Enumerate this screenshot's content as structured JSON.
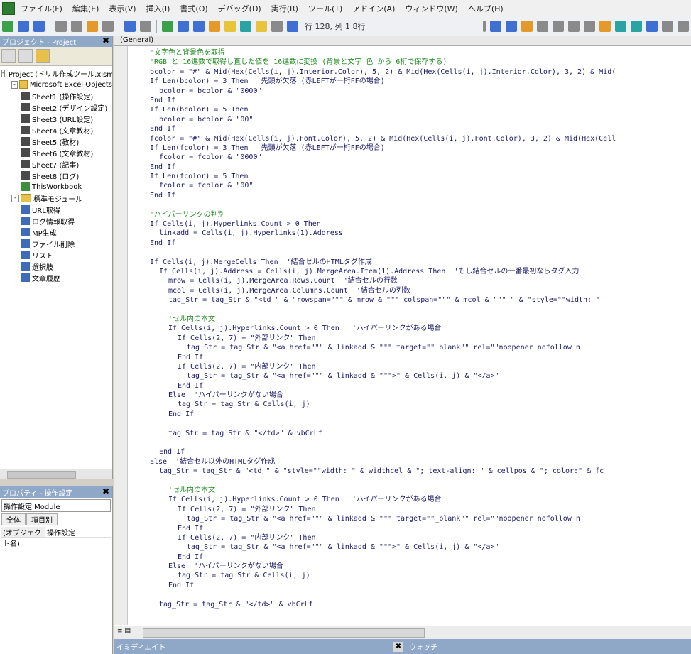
{
  "menubar": {
    "items": [
      "ファイル(F)",
      "編集(E)",
      "表示(V)",
      "挿入(I)",
      "書式(O)",
      "デバッグ(D)",
      "実行(R)",
      "ツール(T)",
      "アドイン(A)",
      "ウィンドウ(W)",
      "ヘルプ(H)"
    ]
  },
  "toolbar": {
    "position_label": "行 128, 列 1 8行"
  },
  "project_pane": {
    "title": "プロジェクト - Project",
    "tree": [
      {
        "label": "Project (ドリル作成ツール.xlsm)",
        "indent": 0,
        "type": "proj",
        "twisty": "-"
      },
      {
        "label": "Microsoft Excel Objects",
        "indent": 1,
        "type": "folder",
        "twisty": "-"
      },
      {
        "label": "Sheet1 (操作設定)",
        "indent": 2,
        "type": "sheet"
      },
      {
        "label": "Sheet2 (デザイン設定)",
        "indent": 2,
        "type": "sheet"
      },
      {
        "label": "Sheet3 (URL設定)",
        "indent": 2,
        "type": "sheet"
      },
      {
        "label": "Sheet4 (文章教材)",
        "indent": 2,
        "type": "sheet"
      },
      {
        "label": "Sheet5 (教材)",
        "indent": 2,
        "type": "sheet"
      },
      {
        "label": "Sheet6 (文章教材)",
        "indent": 2,
        "type": "sheet"
      },
      {
        "label": "Sheet7 (記事)",
        "indent": 2,
        "type": "sheet"
      },
      {
        "label": "Sheet8 (ログ)",
        "indent": 2,
        "type": "sheet"
      },
      {
        "label": "ThisWorkbook",
        "indent": 2,
        "type": "wb"
      },
      {
        "label": "標準モジュール",
        "indent": 1,
        "type": "folder",
        "twisty": "-"
      },
      {
        "label": "URL取得",
        "indent": 2,
        "type": "mod"
      },
      {
        "label": "ログ情報取得",
        "indent": 2,
        "type": "mod"
      },
      {
        "label": "MP生成",
        "indent": 2,
        "type": "mod"
      },
      {
        "label": "ファイル削除",
        "indent": 2,
        "type": "mod"
      },
      {
        "label": "リスト",
        "indent": 2,
        "type": "mod"
      },
      {
        "label": "選択肢",
        "indent": 2,
        "type": "mod"
      },
      {
        "label": "文章履歴",
        "indent": 2,
        "type": "mod"
      }
    ]
  },
  "props_pane": {
    "title": "プロパティ - 操作設定",
    "object_select": "操作設定 Module",
    "tabs": [
      "全体",
      "項目別"
    ],
    "rows": [
      {
        "key": "(オブジェクト名)",
        "value": "操作設定"
      }
    ]
  },
  "code_window": {
    "title": "(General)",
    "lines": [
      {
        "indent": 4,
        "kind": "comment",
        "text": "'文字色と背景色を取得"
      },
      {
        "indent": 4,
        "kind": "comment",
        "text": "'RGB と 16進数で取得し直した値を 16進数に変換 (背景と文字 色 から 6桁で保存する)"
      },
      {
        "indent": 4,
        "kind": "code",
        "text": "bcolor = \"#\" & Mid(Hex(Cells(i, j).Interior.Color), 5, 2) & Mid(Hex(Cells(i, j).Interior.Color), 3, 2) & Mid("
      },
      {
        "indent": 4,
        "kind": "code",
        "text": "If Len(bcolor) = 3 Then  '先頭が欠落 (赤LEFTが一桁FFの場合)"
      },
      {
        "indent": 6,
        "kind": "code",
        "text": "bcolor = bcolor & \"0000\""
      },
      {
        "indent": 4,
        "kind": "code",
        "text": "End If"
      },
      {
        "indent": 4,
        "kind": "code",
        "text": "If Len(bcolor) = 5 Then"
      },
      {
        "indent": 6,
        "kind": "code",
        "text": "bcolor = bcolor & \"00\""
      },
      {
        "indent": 4,
        "kind": "code",
        "text": "End If"
      },
      {
        "indent": 4,
        "kind": "code",
        "text": "fcolor = \"#\" & Mid(Hex(Cells(i, j).Font.Color), 5, 2) & Mid(Hex(Cells(i, j).Font.Color), 3, 2) & Mid(Hex(Cell"
      },
      {
        "indent": 4,
        "kind": "code",
        "text": "If Len(fcolor) = 3 Then  '先頭が欠落 (赤LEFTが一桁FFの場合)"
      },
      {
        "indent": 6,
        "kind": "code",
        "text": "fcolor = fcolor & \"0000\""
      },
      {
        "indent": 4,
        "kind": "code",
        "text": "End If"
      },
      {
        "indent": 4,
        "kind": "code",
        "text": "If Len(fcolor) = 5 Then"
      },
      {
        "indent": 6,
        "kind": "code",
        "text": "fcolor = fcolor & \"00\""
      },
      {
        "indent": 4,
        "kind": "code",
        "text": "End If"
      },
      {
        "indent": 0,
        "kind": "code",
        "text": ""
      },
      {
        "indent": 4,
        "kind": "comment",
        "text": "'ハイパーリンクの判別"
      },
      {
        "indent": 4,
        "kind": "code",
        "text": "If Cells(i, j).Hyperlinks.Count > 0 Then"
      },
      {
        "indent": 6,
        "kind": "code",
        "text": "linkadd = Cells(i, j).Hyperlinks(1).Address"
      },
      {
        "indent": 4,
        "kind": "code",
        "text": "End If"
      },
      {
        "indent": 0,
        "kind": "code",
        "text": ""
      },
      {
        "indent": 4,
        "kind": "code",
        "text": "If Cells(i, j).MergeCells Then  '結合セルのHTMLタグ作成"
      },
      {
        "indent": 6,
        "kind": "code",
        "text": "If Cells(i, j).Address = Cells(i, j).MergeArea.Item(1).Address Then  'もし結合セルの一番最初ならタグ入力"
      },
      {
        "indent": 8,
        "kind": "code",
        "text": "mrow = Cells(i, j).MergeArea.Rows.Count  '結合セルの行数"
      },
      {
        "indent": 8,
        "kind": "code",
        "text": "mcol = Cells(i, j).MergeArea.Columns.Count  '結合セルの列数"
      },
      {
        "indent": 8,
        "kind": "code",
        "text": "tag_Str = tag_Str & \"<td \" & \"rowspan=\"\"\" & mrow & \"\"\" colspan=\"\"\" & mcol & \"\"\" \" & \"style=\"\"width: \""
      },
      {
        "indent": 0,
        "kind": "code",
        "text": ""
      },
      {
        "indent": 8,
        "kind": "comment",
        "text": "'セル内の本文"
      },
      {
        "indent": 8,
        "kind": "code",
        "text": "If Cells(i, j).Hyperlinks.Count > 0 Then   'ハイパーリンクがある場合"
      },
      {
        "indent": 10,
        "kind": "code",
        "text": "If Cells(2, 7) = \"外部リンク\" Then"
      },
      {
        "indent": 12,
        "kind": "code",
        "text": "tag_Str = tag_Str & \"<a href=\"\"\" & linkadd & \"\"\" target=\"\"_blank\"\" rel=\"\"noopener nofollow n"
      },
      {
        "indent": 10,
        "kind": "code",
        "text": "End If"
      },
      {
        "indent": 10,
        "kind": "code",
        "text": "If Cells(2, 7) = \"内部リンク\" Then"
      },
      {
        "indent": 12,
        "kind": "code",
        "text": "tag_Str = tag_Str & \"<a href=\"\"\" & linkadd & \"\"\">\" & Cells(i, j) & \"</a>\""
      },
      {
        "indent": 10,
        "kind": "code",
        "text": "End If"
      },
      {
        "indent": 8,
        "kind": "code",
        "text": "Else  'ハイパーリンクがない場合"
      },
      {
        "indent": 10,
        "kind": "code",
        "text": "tag_Str = tag_Str & Cells(i, j)"
      },
      {
        "indent": 8,
        "kind": "code",
        "text": "End If"
      },
      {
        "indent": 0,
        "kind": "code",
        "text": ""
      },
      {
        "indent": 8,
        "kind": "code",
        "text": "tag_Str = tag_Str & \"</td>\" & vbCrLf"
      },
      {
        "indent": 0,
        "kind": "code",
        "text": ""
      },
      {
        "indent": 6,
        "kind": "code",
        "text": "End If"
      },
      {
        "indent": 4,
        "kind": "code",
        "text": "Else  '結合セル以外のHTMLタグ作成"
      },
      {
        "indent": 6,
        "kind": "code",
        "text": "tag_Str = tag_Str & \"<td \" & \"style=\"\"width: \" & widthcel & \"; text-align: \" & cellpos & \"; color:\" & fc"
      },
      {
        "indent": 0,
        "kind": "code",
        "text": ""
      },
      {
        "indent": 8,
        "kind": "comment",
        "text": "'セル内の本文"
      },
      {
        "indent": 8,
        "kind": "code",
        "text": "If Cells(i, j).Hyperlinks.Count > 0 Then   'ハイパーリンクがある場合"
      },
      {
        "indent": 10,
        "kind": "code",
        "text": "If Cells(2, 7) = \"外部リンク\" Then"
      },
      {
        "indent": 12,
        "kind": "code",
        "text": "tag_Str = tag_Str & \"<a href=\"\"\" & linkadd & \"\"\" target=\"\"_blank\"\" rel=\"\"noopener nofollow n"
      },
      {
        "indent": 10,
        "kind": "code",
        "text": "End If"
      },
      {
        "indent": 10,
        "kind": "code",
        "text": "If Cells(2, 7) = \"内部リンク\" Then"
      },
      {
        "indent": 12,
        "kind": "code",
        "text": "tag_Str = tag_Str & \"<a href=\"\"\" & linkadd & \"\"\">\" & Cells(i, j) & \"</a>\""
      },
      {
        "indent": 10,
        "kind": "code",
        "text": "End If"
      },
      {
        "indent": 8,
        "kind": "code",
        "text": "Else  'ハイパーリンクがない場合"
      },
      {
        "indent": 10,
        "kind": "code",
        "text": "tag_Str = tag_Str & Cells(i, j)"
      },
      {
        "indent": 8,
        "kind": "code",
        "text": "End If"
      },
      {
        "indent": 0,
        "kind": "code",
        "text": ""
      },
      {
        "indent": 6,
        "kind": "code",
        "text": "tag_Str = tag_Str & \"</td>\" & vbCrLf"
      }
    ]
  },
  "bottom_strip": {
    "left_label": "イミディエイト",
    "right_label": "ウォッチ"
  },
  "colors": {
    "code_text": "#1a1a6a",
    "comment_text": "#1c8a1c",
    "pane_title_bg": "#8fa8c8"
  }
}
